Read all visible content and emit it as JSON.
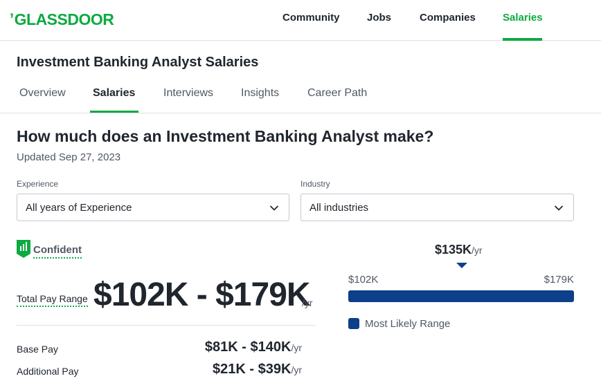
{
  "brand": {
    "logo_text": "GLASSDOOR",
    "accent_color": "#0caa41",
    "dark_blue": "#0d3f8a"
  },
  "nav": {
    "items": [
      "Community",
      "Jobs",
      "Companies",
      "Salaries"
    ],
    "active": "Salaries"
  },
  "page": {
    "title": "Investment Banking Analyst Salaries",
    "tabs": [
      "Overview",
      "Salaries",
      "Interviews",
      "Insights",
      "Career Path"
    ],
    "active_tab": "Salaries"
  },
  "main": {
    "question": "How much does an Investment Banking Analyst make?",
    "updated": "Updated Sep 27, 2023",
    "filters": {
      "experience": {
        "label": "Experience",
        "value": "All years of Experience"
      },
      "industry": {
        "label": "Industry",
        "value": "All industries"
      }
    },
    "confidence": {
      "label": "Confident",
      "icon": "confidence-bars-icon"
    },
    "total_pay": {
      "label": "Total Pay Range",
      "value": "$102K - $179K",
      "unit": "/yr"
    },
    "base_pay": {
      "label": "Base Pay",
      "value": "$81K - $140K",
      "unit": "/yr"
    },
    "additional_pay": {
      "label": "Additional Pay",
      "value": "$21K - $39K",
      "unit": "/yr"
    }
  },
  "range_chart": {
    "median": "$135K",
    "median_unit": "/yr",
    "median_value": 135,
    "min_label": "$102K",
    "max_label": "$179K",
    "min_value": 102,
    "max_value": 179,
    "legend": "Most Likely Range"
  }
}
